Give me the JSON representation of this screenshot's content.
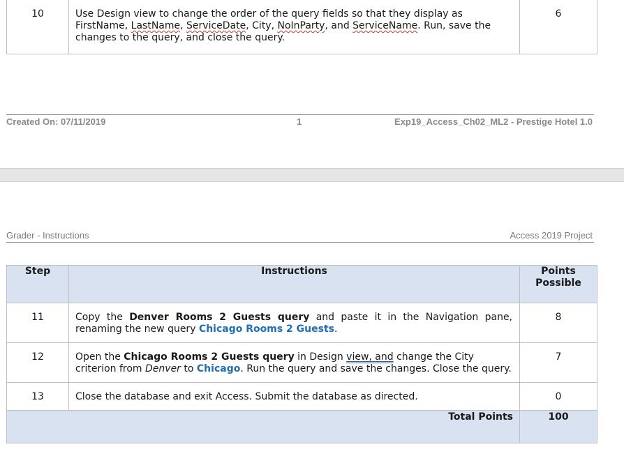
{
  "page1": {
    "row10": {
      "step": "10",
      "points": "6"
    },
    "footer": {
      "created": "Created On: 07/11/2019",
      "page": "1",
      "doc": "Exp19_Access_Ch02_ML2 - Prestige Hotel 1.0"
    }
  },
  "page2": {
    "header": {
      "left": "Grader - Instructions",
      "right": "Access 2019 Project"
    },
    "table": {
      "headers": [
        "Step",
        "Instructions",
        "Points Possible"
      ],
      "rows": [
        {
          "step": "11",
          "points": "8"
        },
        {
          "step": "12",
          "points": "7"
        },
        {
          "step": "13",
          "points": "0"
        }
      ],
      "total_label": "Total Points",
      "total_value": "100"
    }
  },
  "text": {
    "r10_a": "Use Design view to change the order of the query fields so that they display as FirstName, ",
    "r10_lastname": "LastName",
    "r10_b": ", ",
    "r10_servicedate": "ServiceDate",
    "r10_c": ", City, ",
    "r10_noinparty": "NoInParty",
    "r10_d": ", and ",
    "r10_servicename": "ServiceName",
    "r10_e": ". Run, save the changes to the query, and close the query.",
    "r11_a": "Copy the ",
    "r11_bold": "Denver Rooms 2 Guests query",
    "r11_b": " and paste it in the Navigation pane, renaming the new query ",
    "r11_blue": "Chicago Rooms 2 Guests",
    "r11_c": ".",
    "r12_a": "Open the ",
    "r12_bold": "Chicago Rooms 2 Guests query",
    "r12_b": " in Design ",
    "r12_view": "view, and",
    "r12_c": " change the City criterion from ",
    "r12_denver": "Denver",
    "r12_d": " to ",
    "r12_chicago": "Chicago",
    "r12_e": ". Run the query and save the changes. Close the query.",
    "r13": "Close the database and exit Access. Submit the database as directed."
  }
}
